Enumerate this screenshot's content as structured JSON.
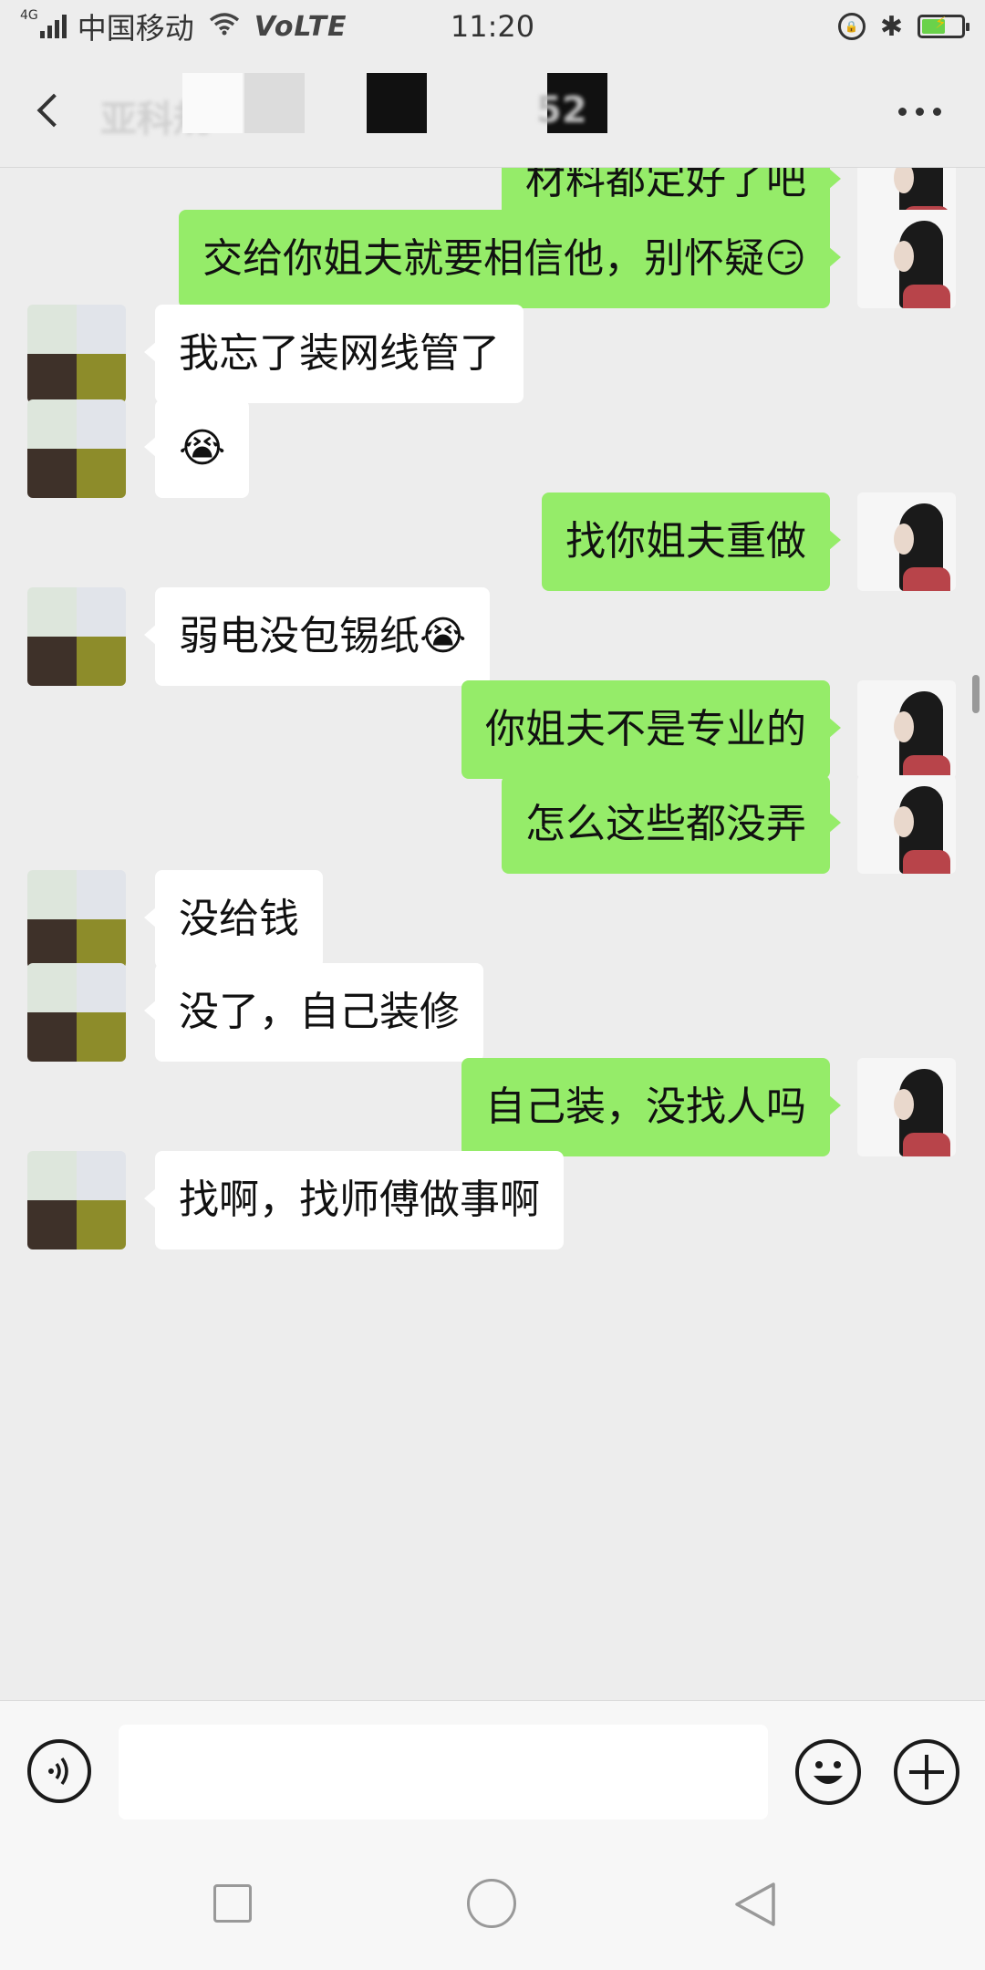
{
  "status_bar": {
    "network": "4G",
    "carrier": "中国移动",
    "volte": "VoLTE",
    "time": "11:20",
    "lock_glyph": "🔒",
    "bluetooth_glyph": "✱",
    "battery_bolt": "⚡",
    "battery_level": 0.6,
    "battery_color": "#6ad24a"
  },
  "header": {
    "title": "亚科规",
    "title_suffix": "52",
    "back_icon": "chevron-left-icon",
    "more_icon": "more-dots-icon"
  },
  "colors": {
    "self_bubble": "#95ec69",
    "other_bubble": "#ffffff",
    "background": "#ededed"
  },
  "messages": [
    {
      "from": "self",
      "text": "材料都定好了吧"
    },
    {
      "from": "self",
      "text": "交给你姐夫就要相信他，别怀疑",
      "emoji": "😏"
    },
    {
      "from": "other",
      "text": "我忘了装网线管了"
    },
    {
      "from": "other",
      "text": "",
      "emoji": "😭"
    },
    {
      "from": "self",
      "text": "找你姐夫重做"
    },
    {
      "from": "other",
      "text": "弱电没包锡纸",
      "emoji": "😭"
    },
    {
      "from": "self",
      "text": "你姐夫不是专业的"
    },
    {
      "from": "self",
      "text": "怎么这些都没弄"
    },
    {
      "from": "other",
      "text": "没给钱"
    },
    {
      "from": "other",
      "text": "没了，自己装修"
    },
    {
      "from": "self",
      "text": "自己装，没找人吗"
    },
    {
      "from": "other",
      "text": "找啊，找师傅做事啊"
    }
  ],
  "input_bar": {
    "placeholder": "",
    "voice_icon": "voice-icon",
    "emoji_icon": "smiley-icon",
    "plus_icon": "plus-icon"
  },
  "nav_bar": {
    "recent_icon": "square-icon",
    "home_icon": "circle-icon",
    "back_icon": "triangle-back-icon"
  }
}
